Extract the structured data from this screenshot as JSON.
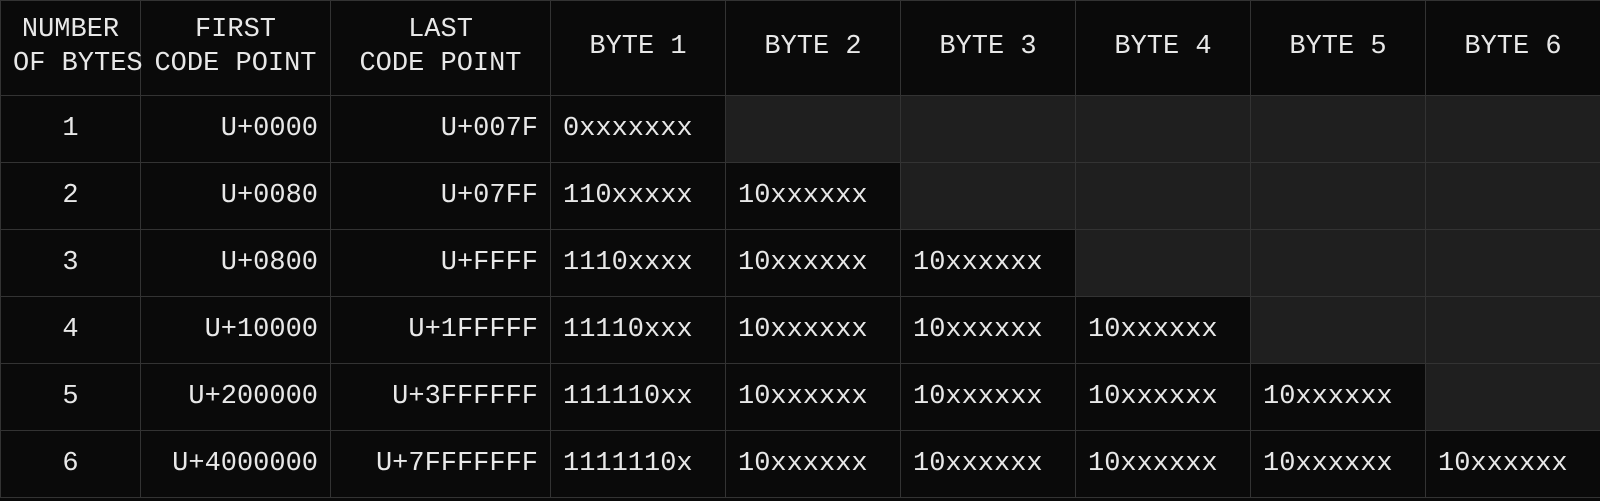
{
  "headers": {
    "num_bytes": "NUMBER\nOF BYTES",
    "first_cp": "FIRST\nCODE POINT",
    "last_cp": "LAST\nCODE POINT",
    "byte1": "BYTE 1",
    "byte2": "BYTE 2",
    "byte3": "BYTE 3",
    "byte4": "BYTE 4",
    "byte5": "BYTE 5",
    "byte6": "BYTE 6"
  },
  "rows": [
    {
      "num": "1",
      "first": "U+0000",
      "last": "U+007F",
      "bytes": [
        "0xxxxxxx",
        "",
        "",
        "",
        "",
        ""
      ]
    },
    {
      "num": "2",
      "first": "U+0080",
      "last": "U+07FF",
      "bytes": [
        "110xxxxx",
        "10xxxxxx",
        "",
        "",
        "",
        ""
      ]
    },
    {
      "num": "3",
      "first": "U+0800",
      "last": "U+FFFF",
      "bytes": [
        "1110xxxx",
        "10xxxxxx",
        "10xxxxxx",
        "",
        "",
        ""
      ]
    },
    {
      "num": "4",
      "first": "U+10000",
      "last": "U+1FFFFF",
      "bytes": [
        "11110xxx",
        "10xxxxxx",
        "10xxxxxx",
        "10xxxxxx",
        "",
        ""
      ]
    },
    {
      "num": "5",
      "first": "U+200000",
      "last": "U+3FFFFFF",
      "bytes": [
        "111110xx",
        "10xxxxxx",
        "10xxxxxx",
        "10xxxxxx",
        "10xxxxxx",
        ""
      ]
    },
    {
      "num": "6",
      "first": "U+4000000",
      "last": "U+7FFFFFFF",
      "bytes": [
        "1111110x",
        "10xxxxxx",
        "10xxxxxx",
        "10xxxxxx",
        "10xxxxxx",
        "10xxxxxx"
      ]
    }
  ]
}
